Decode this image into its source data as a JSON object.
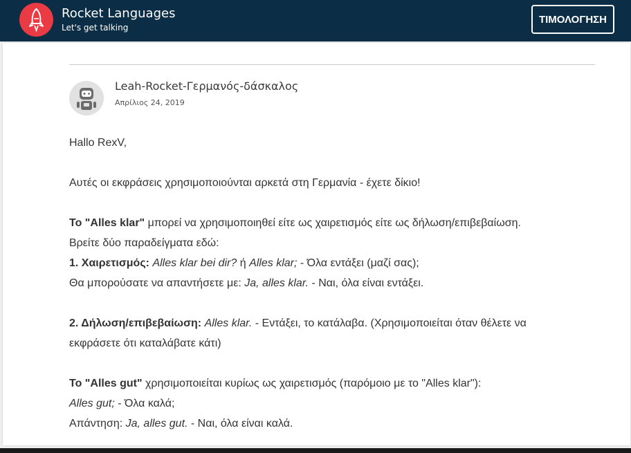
{
  "header": {
    "brand_name": "Rocket Languages",
    "tagline": "Let's get talking",
    "pricing_button": "ΤΙΜΟΛΟΓΗΣΗ",
    "background_color": "#0b2d45",
    "logo_color": "#ea3a43"
  },
  "post": {
    "author": "Leah-Rocket-Γερμανός-δάσκαλος",
    "date": "Απρίλιος 24, 2019",
    "greeting": "Hallo RexV,",
    "intro": "Αυτές οι εκφράσεις χρησιμοποιούνται αρκετά στη Γερμανία - έχετε δίκιο!",
    "klar": {
      "lead_bold": "Το \"Alles klar\"",
      "lead_rest": " μπορεί να χρησιμοποιηθεί είτε ως χαιρετισμός είτε ως δήλωση/επιβεβαίωση.",
      "examples_intro": "Βρείτε δύο παραδείγματα εδώ:",
      "ex1_label": "1. Χαιρετισμός:",
      "ex1_q1": "Alles klar bei dir?",
      "ex1_or": " ή ",
      "ex1_q2": "Alles klar;",
      "ex1_translation": " - Όλα εντάξει (μαζί σας);",
      "ex1_reply_prefix": "Θα μπορούσατε να απαντήσετε με: ",
      "ex1_reply": "Ja, alles klar.",
      "ex1_reply_translation": " - Ναι, όλα είναι εντάξει.",
      "ex2_label": "2. Δήλωση/επιβεβαίωση:",
      "ex2_phrase": "Alles klar.",
      "ex2_translation_line1": " - Εντάξει, το κατάλαβα. (Χρησιμοποιείται όταν θέλετε να",
      "ex2_translation_line2": "εκφράσετε ότι καταλάβατε κάτι)"
    },
    "gut": {
      "lead_bold": "Το \"Alles gut\"",
      "lead_rest": " χρησιμοποιείται κυρίως ως χαιρετισμός (παρόμοιο με το \"Alles klar\"):",
      "phrase": "Alles gut;",
      "phrase_translation": " - Όλα καλά;",
      "answer_prefix": "Απάντηση: ",
      "answer": "Ja, alles gut.",
      "answer_translation": " - Ναι, όλα είναι καλά."
    }
  }
}
